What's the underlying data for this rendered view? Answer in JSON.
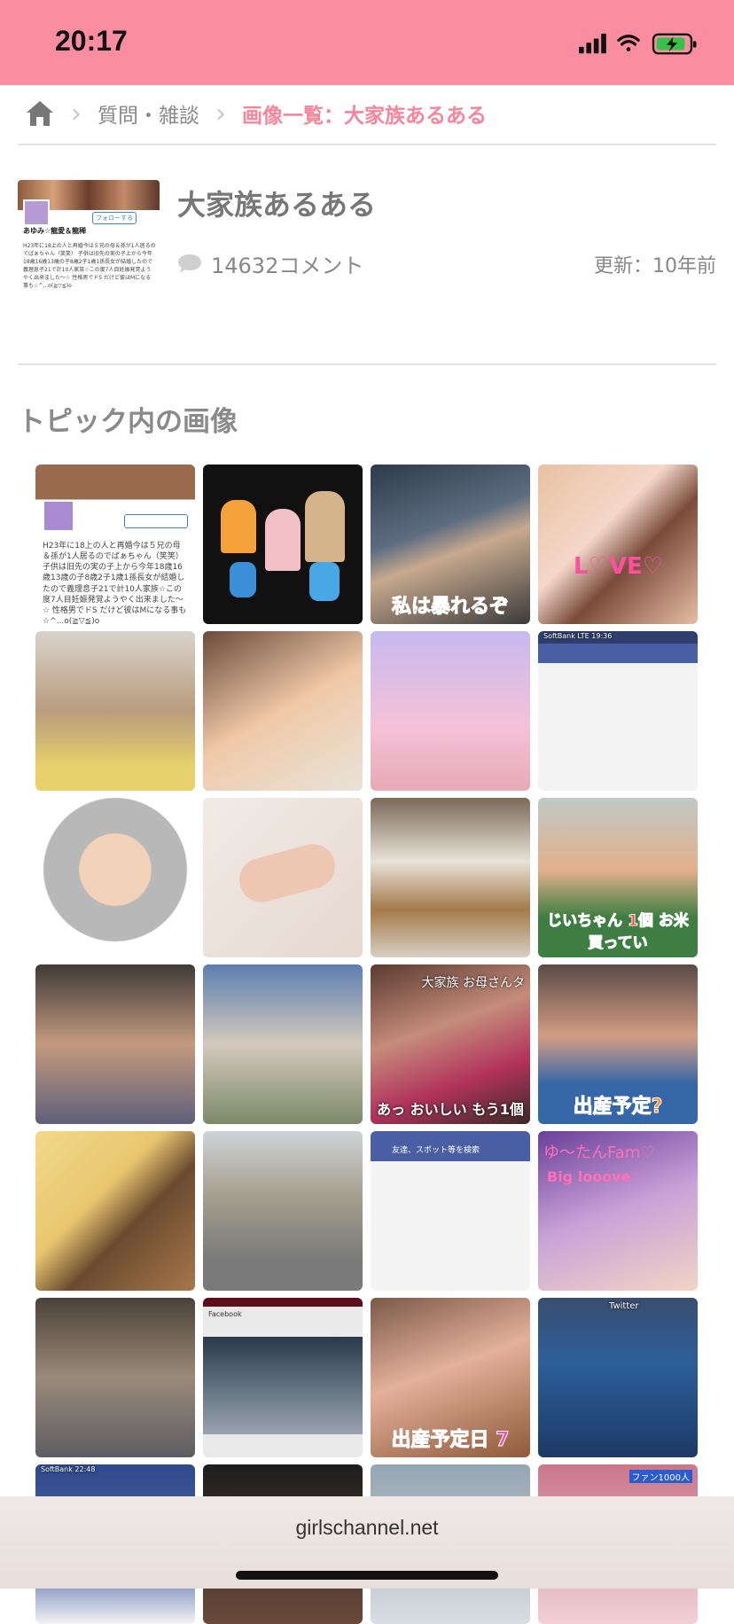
{
  "status": {
    "time": "20:17"
  },
  "breadcrumb": {
    "home_icon": "home-icon",
    "items": [
      "質問・雑談"
    ],
    "current": "画像一覧：大家族あるある"
  },
  "topic": {
    "title": "大家族あるある",
    "comments": "14632コメント",
    "updated": "更新：10年前",
    "thumb_name": "あゆみ☆龍愛＆龍稀",
    "thumb_follow": "フォローする",
    "thumb_text": "H23年に18上の人と再婚今は５兄の母＆孫が1人居るのでばぁちゃん（笑笑） 子供は旧先の実の子上から今年18歳16歳13歳の子8歳2子1歳1孫長女が結婚したので義理息子21で計10人家族☆この度7人目妊娠発覚ようやく出来ました〜☆ 性格男でドS だけど彼はMになる事も☆^...o(≧▽≦)o"
  },
  "section_title": "トピック内の画像",
  "images": [
    {
      "caption": "",
      "sub": ""
    },
    {
      "caption": "",
      "sub": ""
    },
    {
      "caption": "私は暴れるぞ",
      "sub": ""
    },
    {
      "caption": "",
      "sub": ""
    },
    {
      "caption": "",
      "sub": ""
    },
    {
      "caption": "",
      "sub": ""
    },
    {
      "caption": "",
      "sub": ""
    },
    {
      "caption": "",
      "sub": "SoftBank LTE 19:36"
    },
    {
      "caption": "",
      "sub": ""
    },
    {
      "caption": "",
      "sub": ""
    },
    {
      "caption": "",
      "sub": ""
    },
    {
      "caption": "じいちゃん 1個 お米買ってい",
      "sub": ""
    },
    {
      "caption": "",
      "sub": ""
    },
    {
      "caption": "",
      "sub": ""
    },
    {
      "caption": "あっ おいしい もう1個",
      "sub": "大家族 お母さんタ"
    },
    {
      "caption": "出産予定?",
      "sub": ""
    },
    {
      "caption": "",
      "sub": ""
    },
    {
      "caption": "",
      "sub": ""
    },
    {
      "caption": "",
      "sub": "友達、スポット等を検索"
    },
    {
      "caption": "Big looove♡",
      "sub": "ゆ〜たんFam♡"
    },
    {
      "caption": "",
      "sub": ""
    },
    {
      "caption": "",
      "sub": "Facebook"
    },
    {
      "caption": "出産予定日 7",
      "sub": ""
    },
    {
      "caption": "",
      "sub": "Twitter"
    },
    {
      "caption": "",
      "sub": "SoftBank 22:48"
    },
    {
      "caption": "",
      "sub": ""
    },
    {
      "caption": "",
      "sub": ""
    },
    {
      "caption": "",
      "sub": "ファン1000人"
    }
  ],
  "footer": {
    "url": "girlschannel.net"
  },
  "colors": {
    "accent": "#fb8da0",
    "crumb_current": "#f7849a"
  }
}
